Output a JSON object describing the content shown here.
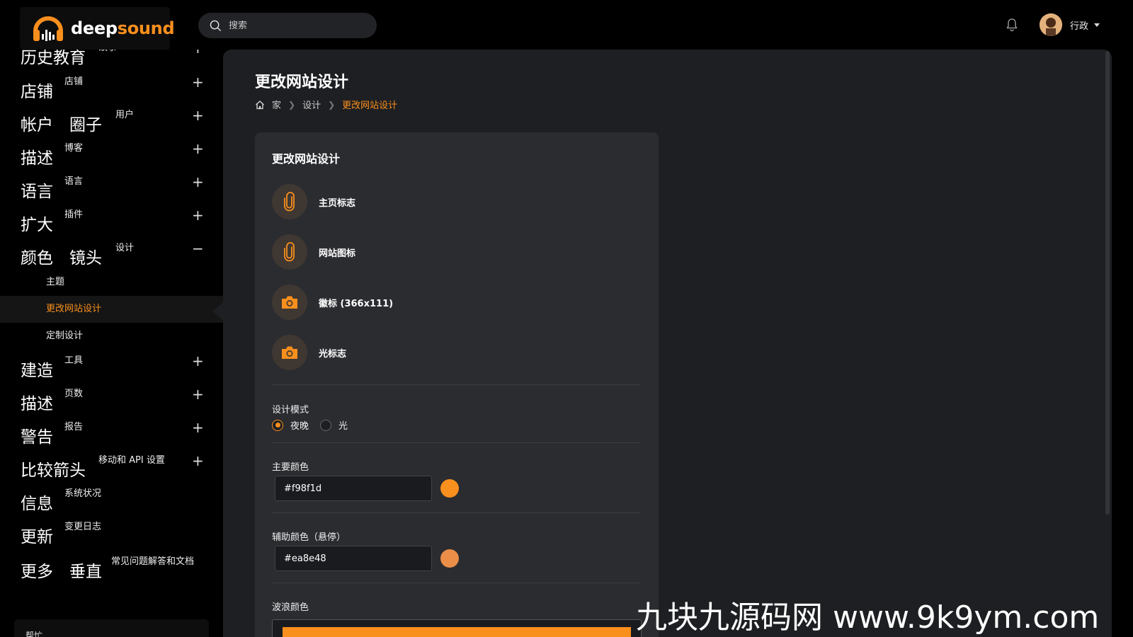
{
  "app": {
    "brand_part1": "deep",
    "brand_part2": "sound",
    "brand_color": "#f98f1d"
  },
  "header": {
    "search_placeholder": "搜索",
    "user_name": "行政"
  },
  "sidebar": {
    "partial_top": {
      "big": "历史教育",
      "small": "故事"
    },
    "items": [
      {
        "big": "店铺",
        "small": "店铺",
        "toggle": "+"
      },
      {
        "big": "帐户　圈子",
        "small": "用户",
        "toggle": "+"
      },
      {
        "big": "描述",
        "small": "博客",
        "toggle": "+"
      },
      {
        "big": "语言",
        "small": "语言",
        "toggle": "+"
      },
      {
        "big": "扩大",
        "small": "插件",
        "toggle": "+"
      },
      {
        "big": "颜色　镜头",
        "small": "设计",
        "toggle": "−"
      }
    ],
    "subitems": [
      {
        "label": "主题"
      },
      {
        "label": "更改网站设计"
      },
      {
        "label": "定制设计"
      }
    ],
    "items2": [
      {
        "big": "建造",
        "small": "工具",
        "toggle": "+"
      },
      {
        "big": "描述",
        "small": "页数",
        "toggle": "+"
      },
      {
        "big": "警告",
        "small": "报告",
        "toggle": "+"
      },
      {
        "big": "比较箭头",
        "small": "移动和 API 设置",
        "toggle": "+"
      },
      {
        "big": "信息",
        "small": "系统状况",
        "toggle": ""
      },
      {
        "big": "更新",
        "small": "变更日志",
        "toggle": ""
      },
      {
        "big": "更多　垂直",
        "small": "常见问题解答和文档",
        "toggle": ""
      }
    ],
    "bottom_card": "帮忙"
  },
  "main": {
    "page_title": "更改网站设计",
    "breadcrumb": {
      "home": "家",
      "section": "设计",
      "current": "更改网站设计"
    },
    "card": {
      "title": "更改网站设计",
      "uploads": [
        {
          "label": "主页标志",
          "icon": "paperclip-icon"
        },
        {
          "label": "网站图标",
          "icon": "paperclip-icon"
        },
        {
          "label": "徽标 (366x111)",
          "icon": "camera-icon"
        },
        {
          "label": "光标志",
          "icon": "camera-icon"
        }
      ],
      "design_mode": {
        "label": "设计模式",
        "options": [
          "夜晚",
          "光"
        ],
        "selected": "夜晚"
      },
      "primary_color": {
        "label": "主要颜色",
        "value": "#f98f1d"
      },
      "secondary_color": {
        "label": "辅助颜色（悬停）",
        "value": "#ea8e48"
      },
      "wave_color": {
        "label": "波浪颜色",
        "value": "#f98f1d"
      }
    }
  },
  "watermark": "九块九源码网 www.9k9ym.com"
}
